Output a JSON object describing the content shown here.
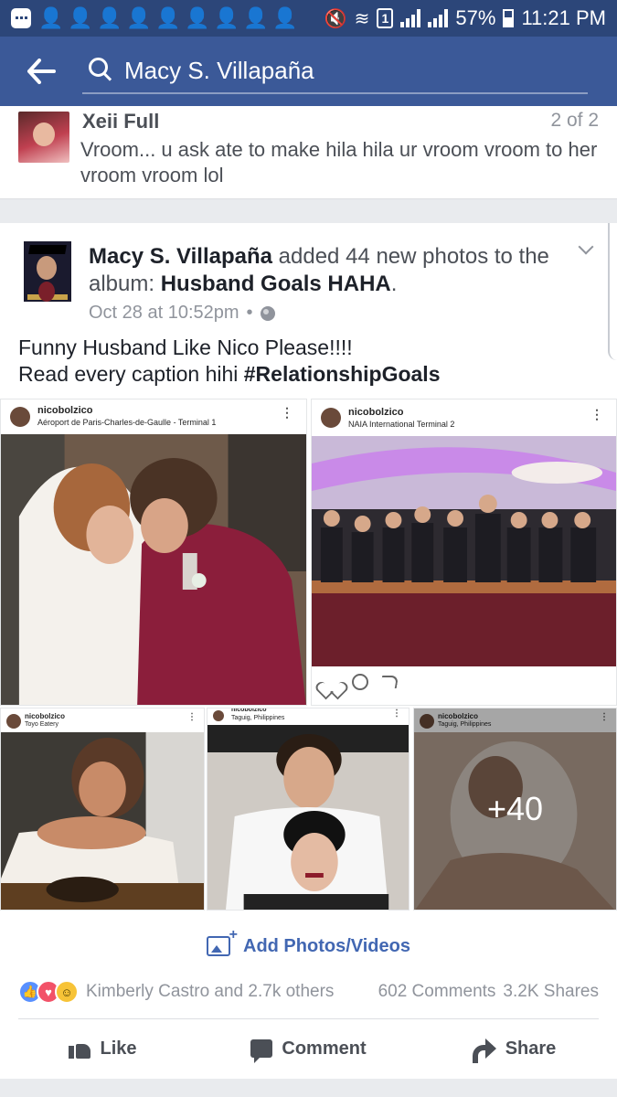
{
  "status_bar": {
    "battery": "57%",
    "time": "11:21 PM",
    "sim_label": "1"
  },
  "search": {
    "query": "Macy S. Villapaña",
    "back_icon": "back-arrow-icon",
    "search_icon": "search-icon"
  },
  "comment": {
    "author": "Xeii Full",
    "position": "2 of 2",
    "text": "Vroom...  u ask ate to make  hila hila ur vroom  vroom to her vroom vroom lol"
  },
  "post": {
    "author": "Macy S. Villapaña",
    "action": " added 44 new photos to the album: ",
    "album": "Husband Goals HAHA",
    "period": ".",
    "timestamp": "Oct 28 at 10:52pm",
    "separator": "•",
    "caption_line1": "Funny Husband Like Nico Please!!!!",
    "caption_line2_prefix": "Read every caption hihi ",
    "caption_hashtag": "#RelationshipGoals",
    "photos": [
      {
        "user": "nicobolzico",
        "location": "Aéroport de Paris-Charles-de-Gaulle - Terminal 1"
      },
      {
        "user": "nicobolzico",
        "location": "NAIA International Terminal 2"
      },
      {
        "user": "nicobolzico",
        "location": "Toyo Eatery"
      },
      {
        "user": "nicobolzico",
        "location": "Taguig, Philippines"
      },
      {
        "user": "nicobolzico",
        "location": "Taguig, Philippines"
      }
    ],
    "more_count": "+40",
    "add_photos_label": "Add Photos/Videos",
    "reactions_text": "Kimberly Castro and 2.7k others",
    "comments_count": "602 Comments",
    "shares_count": "3.2K Shares",
    "like_label": "Like",
    "comment_label": "Comment",
    "share_label": "Share"
  },
  "colors": {
    "status_bar": "#2c4679",
    "header": "#3b5998",
    "link_blue": "#4267b2",
    "like_blue": "#5890ff",
    "love_red": "#f25268",
    "haha_yellow": "#f7c337"
  }
}
